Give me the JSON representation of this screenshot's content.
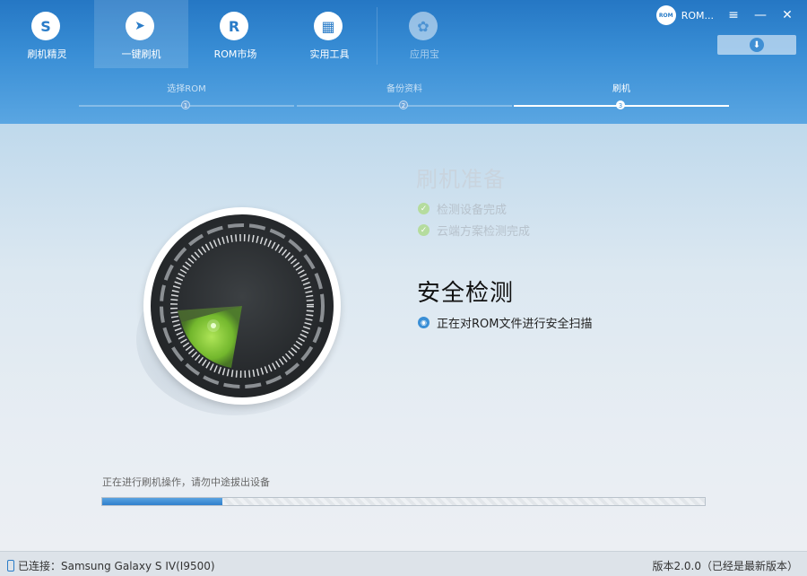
{
  "nav": {
    "items": [
      {
        "label": "刷机精灵",
        "icon": "shield-s-icon",
        "glyph": "S"
      },
      {
        "label": "一键刷机",
        "icon": "cursor-play-icon",
        "glyph": "➤"
      },
      {
        "label": "ROM市场",
        "icon": "rom-r-icon",
        "glyph": "R"
      },
      {
        "label": "实用工具",
        "icon": "grid-apps-icon",
        "glyph": "▦"
      },
      {
        "label": "应用宝",
        "icon": "yingyongbao-icon",
        "glyph": "✿"
      }
    ]
  },
  "window": {
    "rom_badge": "ROM",
    "rom_label": "ROM...",
    "menu_glyph": "≡",
    "minimize_glyph": "—",
    "close_glyph": "✕",
    "download_glyph": "⬇"
  },
  "steps": [
    {
      "label": "选择ROM",
      "num": "1"
    },
    {
      "label": "备份资料",
      "num": "2"
    },
    {
      "label": "刷机",
      "num": "3"
    }
  ],
  "prep": {
    "title": "刷机准备",
    "checks": [
      "检测设备完成",
      "云端方案检测完成"
    ],
    "check_glyph": "✓"
  },
  "security": {
    "title": "安全检测",
    "status": "正在对ROM文件进行安全扫描",
    "status_glyph": "◉"
  },
  "progress": {
    "text": "正在进行刷机操作，请勿中途拔出设备",
    "fraction": 0.2
  },
  "status": {
    "connected": "已连接：Samsung Galaxy S IV(I9500)",
    "version": "版本2.0.0（已经是最新版本）"
  },
  "colors": {
    "header_blue": "#2a7cc8",
    "radar_green": "#8bd33a",
    "progress_blue": "#2f7fcc"
  }
}
